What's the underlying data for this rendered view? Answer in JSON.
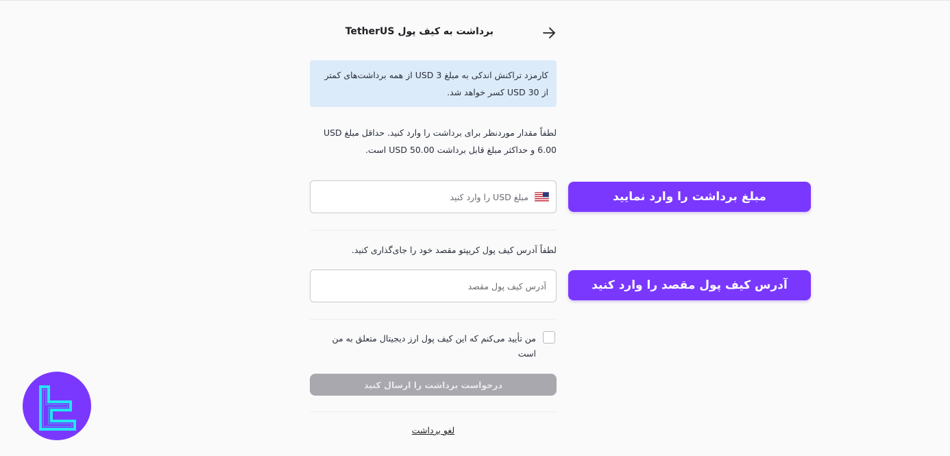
{
  "header": {
    "title": "برداشت به کیف پول TetherUS",
    "back_icon": "arrow-right-icon"
  },
  "notice": {
    "line1": "کارمزد تراکنش اندکی به مبلغ 3 USD از همه برداشت‌های کمتر",
    "line2": "از 30 USD کسر خواهد شد."
  },
  "amount": {
    "instruction_line1": "لطفاً مقدار موردنظر برای برداشت را وارد کنید. حداقل مبلغ USD",
    "instruction_line2": "6.00 و حداکثر مبلغ قابل برداشت 50.00 USD است.",
    "placeholder": "مبلغ USD را وارد کنید",
    "value": "",
    "flag_icon": "us-flag-icon"
  },
  "address": {
    "instruction": "لطفاً آدرس کیف پول کریپتو مقصد خود را جای‌گذاری کنید.",
    "placeholder": "آدرس کیف پول مقصد",
    "value": ""
  },
  "confirm": {
    "checked": false,
    "label_line1": "من تأیید می‌کنم که این کیف پول ارز دیجیتال متعلق به من",
    "label_line2": "است"
  },
  "submit_label": "درخواست برداشت را ارسال کنید",
  "cancel_label": "لغو برداشت",
  "callouts": {
    "amount": "مبلغ برداشت را وارد نمایید",
    "address": "آدرس کیف پول مقصد را وارد کنید"
  },
  "colors": {
    "accent": "#7a38ff",
    "notice_bg": "#dcebf9",
    "disabled_button": "#a8a8ae",
    "logo_mark": "#22e6f2"
  }
}
